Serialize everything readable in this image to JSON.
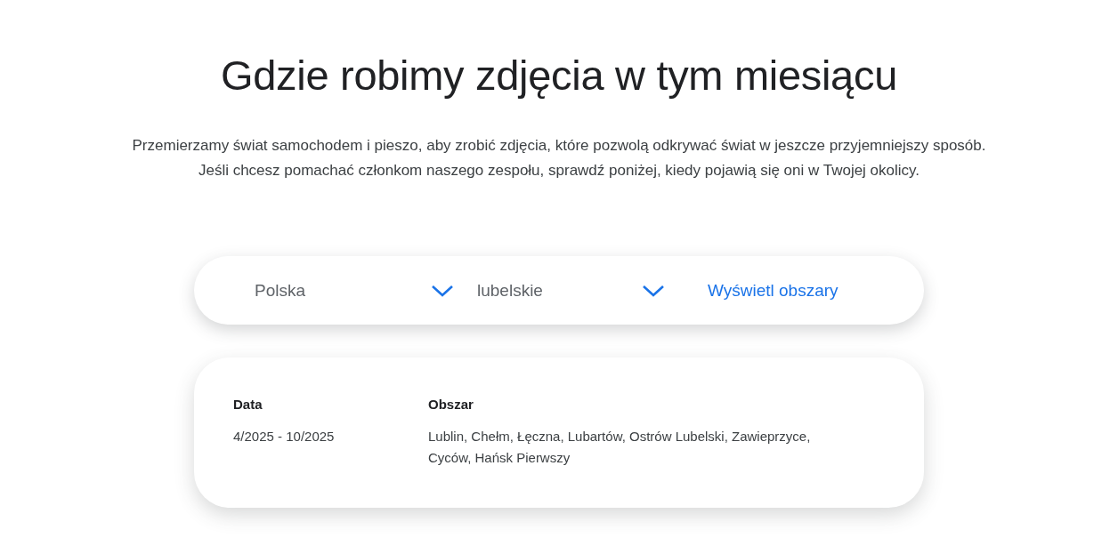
{
  "title": "Gdzie robimy zdjęcia w tym miesiącu",
  "description": [
    "Przemierzamy świat samochodem i pieszo, aby zrobić zdjęcia, które pozwolą odkrywać świat w jeszcze przyjemniejszy sposób.",
    "Jeśli chcesz pomachać członkom naszego zespołu, sprawdź poniżej, kiedy pojawią się oni w Twojej okolicy."
  ],
  "filters": [
    {
      "kind": "dropdown",
      "value": "Polska"
    },
    {
      "kind": "dropdown",
      "value": "lubelskie"
    },
    {
      "kind": "link",
      "label": "Wyświetl obszary"
    }
  ],
  "table": {
    "columns": [
      "Data",
      "Obszar"
    ],
    "rows": [
      [
        "4/2025 - 10/2025",
        "Lublin, Chełm, Łęczna, Lubartów, Ostrów Lubelski, Zawieprzyce, Cyców, Hańsk Pierwszy"
      ]
    ]
  }
}
